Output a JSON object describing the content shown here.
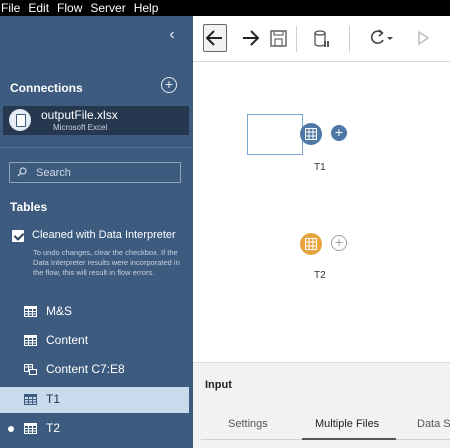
{
  "menu": [
    "File",
    "Edit",
    "Flow",
    "Server",
    "Help"
  ],
  "sidebar": {
    "collapse_icon": "chevron-left-icon",
    "connections_title": "Connections",
    "connection": {
      "name": "outputFile.xlsx",
      "type": "Microsoft Excel"
    },
    "search_placeholder": "Search",
    "tables_title": "Tables",
    "interpreter": {
      "checked": true,
      "label": "Cleaned with Data Interpreter",
      "help": "To undo changes, clear the checkbox. If the Data Interpreter results were incorporated in the flow, this will result in flow errors."
    },
    "tables": [
      {
        "label": "M&S",
        "icon": "table-icon",
        "selected": false,
        "in_flow": false
      },
      {
        "label": "Content",
        "icon": "table-icon",
        "selected": false,
        "in_flow": false
      },
      {
        "label": "Content C7:E8",
        "icon": "named-range-icon",
        "selected": false,
        "in_flow": false
      },
      {
        "label": "T1",
        "icon": "table-icon",
        "selected": true,
        "in_flow": false
      },
      {
        "label": "T2",
        "icon": "table-icon",
        "selected": false,
        "in_flow": true
      }
    ]
  },
  "toolbar": {
    "buttons": [
      "undo-icon",
      "redo-icon",
      "save-icon",
      "data-cylinder-icon",
      "refresh-icon",
      "run-icon"
    ]
  },
  "canvas": {
    "nodes": [
      {
        "label": "T1",
        "color": "#4e79a7",
        "selected": true
      },
      {
        "label": "T2",
        "color": "#e8a33d",
        "selected": false
      }
    ]
  },
  "bottom_panel": {
    "title": "Input",
    "tabs": [
      "Settings",
      "Multiple Files",
      "Data S"
    ],
    "active_tab": "Multiple Files"
  },
  "colors": {
    "sidebar_bg": "#3d5a7f",
    "selected_bg": "#c8dbee",
    "accent_blue": "#4e79a7",
    "accent_orange": "#e8a33d"
  }
}
